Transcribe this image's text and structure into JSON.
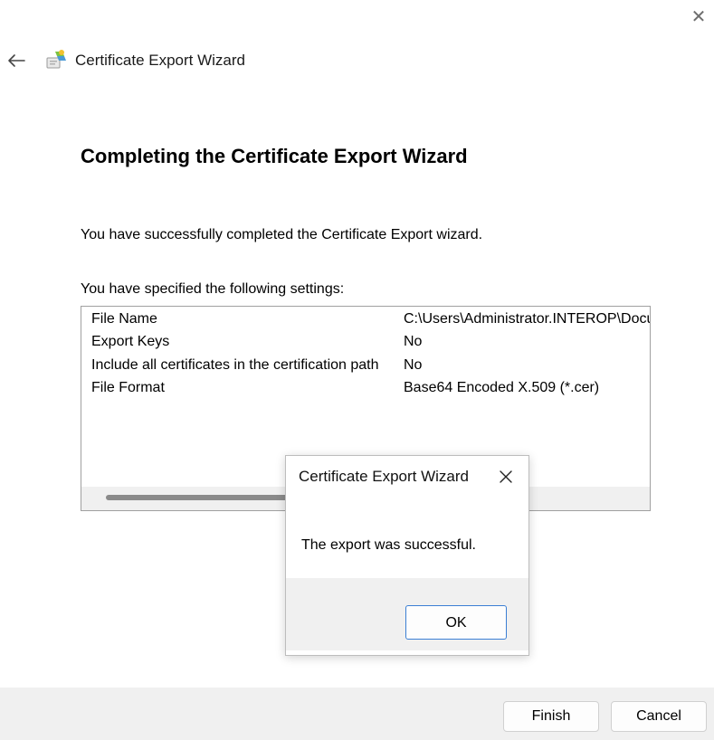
{
  "window": {
    "title": "Certificate Export Wizard",
    "close_icon": "close-icon",
    "back_icon": "back-arrow-icon"
  },
  "main": {
    "heading": "Completing the Certificate Export Wizard",
    "success_text": "You have successfully completed the Certificate Export wizard.",
    "settings_label": "You have specified the following settings:",
    "settings": [
      {
        "key": "File Name",
        "value": "C:\\Users\\Administrator.INTEROP\\Docu"
      },
      {
        "key": "Export Keys",
        "value": "No"
      },
      {
        "key": "Include all certificates in the certification path",
        "value": "No"
      },
      {
        "key": "File Format",
        "value": "Base64 Encoded X.509 (*.cer)"
      }
    ]
  },
  "footer": {
    "finish_label": "Finish",
    "cancel_label": "Cancel"
  },
  "modal": {
    "title": "Certificate Export Wizard",
    "message": "The export was successful.",
    "ok_label": "OK"
  },
  "colors": {
    "footer_bg": "#f0f0f0",
    "ok_border": "#3b7fd4"
  }
}
